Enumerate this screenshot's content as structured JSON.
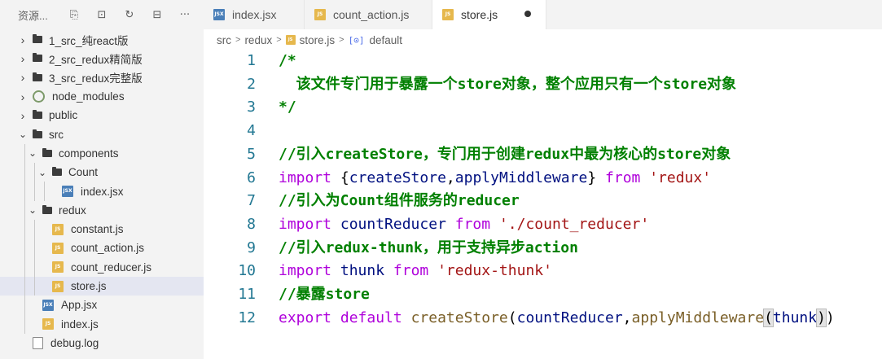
{
  "sidebar": {
    "title": "资源...",
    "actions": [
      {
        "name": "new-file-icon",
        "glyph": "⎘"
      },
      {
        "name": "new-folder-icon",
        "glyph": "⊡"
      },
      {
        "name": "refresh-icon",
        "glyph": "↻"
      },
      {
        "name": "collapse-all-icon",
        "glyph": "⊟"
      },
      {
        "name": "more-icon",
        "glyph": "···"
      }
    ],
    "tree": [
      {
        "label": "1_src_纯react版",
        "type": "folder",
        "expanded": false,
        "depth": 0
      },
      {
        "label": "2_src_redux精简版",
        "type": "folder",
        "expanded": false,
        "depth": 0
      },
      {
        "label": "3_src_redux完整版",
        "type": "folder",
        "expanded": false,
        "depth": 0
      },
      {
        "label": "node_modules",
        "type": "modules",
        "expanded": false,
        "depth": 0
      },
      {
        "label": "public",
        "type": "folder",
        "expanded": false,
        "depth": 0
      },
      {
        "label": "src",
        "type": "folder",
        "expanded": true,
        "depth": 0
      },
      {
        "label": "components",
        "type": "folder",
        "expanded": true,
        "depth": 1
      },
      {
        "label": "Count",
        "type": "folder",
        "expanded": true,
        "depth": 2
      },
      {
        "label": "index.jsx",
        "type": "jsx",
        "depth": 3
      },
      {
        "label": "redux",
        "type": "folder",
        "expanded": true,
        "depth": 1
      },
      {
        "label": "constant.js",
        "type": "js",
        "depth": 2
      },
      {
        "label": "count_action.js",
        "type": "js",
        "depth": 2
      },
      {
        "label": "count_reducer.js",
        "type": "js",
        "depth": 2
      },
      {
        "label": "store.js",
        "type": "js",
        "depth": 2,
        "selected": true
      },
      {
        "label": "App.jsx",
        "type": "jsx",
        "depth": 1
      },
      {
        "label": "index.js",
        "type": "js",
        "depth": 1
      },
      {
        "label": "debug.log",
        "type": "log",
        "depth": 0
      }
    ]
  },
  "tabs": [
    {
      "label": "index.jsx",
      "type": "jsx",
      "active": false,
      "dirty": false
    },
    {
      "label": "count_action.js",
      "type": "js",
      "active": false,
      "dirty": false
    },
    {
      "label": "store.js",
      "type": "js",
      "active": true,
      "dirty": true
    }
  ],
  "breadcrumb": [
    "src",
    "redux",
    "store.js",
    "default"
  ],
  "file_badges": {
    "js": "JS",
    "jsx": "JSX"
  },
  "code": [
    {
      "n": "1",
      "tokens": [
        [
          "c-comment",
          "/*"
        ]
      ]
    },
    {
      "n": "2",
      "tokens": [
        [
          "c-comment",
          "  该文件专门用于暴露一个store对象，整个应用只有一个store对象"
        ]
      ]
    },
    {
      "n": "3",
      "tokens": [
        [
          "c-comment",
          "*/"
        ]
      ]
    },
    {
      "n": "4",
      "tokens": []
    },
    {
      "n": "5",
      "tokens": [
        [
          "c-comment",
          "//引入createStore，专门用于创建redux中最为核心的store对象"
        ]
      ]
    },
    {
      "n": "6",
      "tokens": [
        [
          "c-kw",
          "import "
        ],
        [
          "c-pun",
          "{"
        ],
        [
          "c-id",
          "createStore"
        ],
        [
          "c-pun",
          ","
        ],
        [
          "c-id",
          "applyMiddleware"
        ],
        [
          "c-pun",
          "} "
        ],
        [
          "c-kw",
          "from "
        ],
        [
          "c-str",
          "'redux'"
        ]
      ]
    },
    {
      "n": "7",
      "tokens": [
        [
          "c-comment",
          "//引入为Count组件服务的reducer"
        ]
      ]
    },
    {
      "n": "8",
      "tokens": [
        [
          "c-kw",
          "import "
        ],
        [
          "c-id",
          "countReducer "
        ],
        [
          "c-kw",
          "from "
        ],
        [
          "c-str",
          "'./count_reducer'"
        ]
      ]
    },
    {
      "n": "9",
      "tokens": [
        [
          "c-comment",
          "//引入redux-thunk，用于支持异步action"
        ]
      ]
    },
    {
      "n": "10",
      "tokens": [
        [
          "c-kw",
          "import "
        ],
        [
          "c-id",
          "thunk "
        ],
        [
          "c-kw",
          "from "
        ],
        [
          "c-str",
          "'redux-thunk'"
        ]
      ]
    },
    {
      "n": "11",
      "tokens": [
        [
          "c-comment",
          "//暴露store"
        ]
      ]
    },
    {
      "n": "12",
      "tokens": [
        [
          "c-kw",
          "export default "
        ],
        [
          "c-fn",
          "createStore"
        ],
        [
          "c-pun",
          "("
        ],
        [
          "c-id",
          "countReducer"
        ],
        [
          "c-pun",
          ","
        ],
        [
          "c-fn",
          "applyMiddleware"
        ],
        [
          "bracket-hl",
          "("
        ],
        [
          "c-id",
          "thunk"
        ],
        [
          "caret",
          ""
        ],
        [
          "bracket-hl",
          ")"
        ],
        [
          "c-pun",
          ")"
        ]
      ]
    }
  ]
}
